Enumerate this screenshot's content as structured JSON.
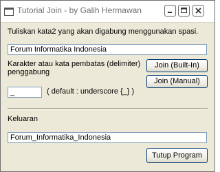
{
  "window": {
    "title": "Tutorial Join - by Galih Hermawan"
  },
  "form": {
    "input_label": "Tuliskan kata2 yang akan digabung menggunakan spasi.",
    "input_value": "Forum Informatika Indonesia",
    "delimiter_label_line1": "Karakter atau kata pembatas (delimiter)",
    "delimiter_label_line2": "penggabung",
    "delimiter_value": "_",
    "delimiter_hint": "( default : underscore {_} )",
    "join_builtin_label": "Join (Built-In)",
    "join_manual_label": "Join (Manual)",
    "output_label": "Keluaran",
    "output_value": "Forum_Informatika_Indonesia",
    "close_label": "Tutup Program"
  },
  "icons": {
    "app": "app-window-icon",
    "minimize": "minimize-icon",
    "maximize": "maximize-icon",
    "close": "close-icon"
  },
  "colors": {
    "window_face": "#ece9d8",
    "title_text": "#6f6f6f",
    "textbox_border": "#7f9db9",
    "button_border": "#003c74"
  }
}
